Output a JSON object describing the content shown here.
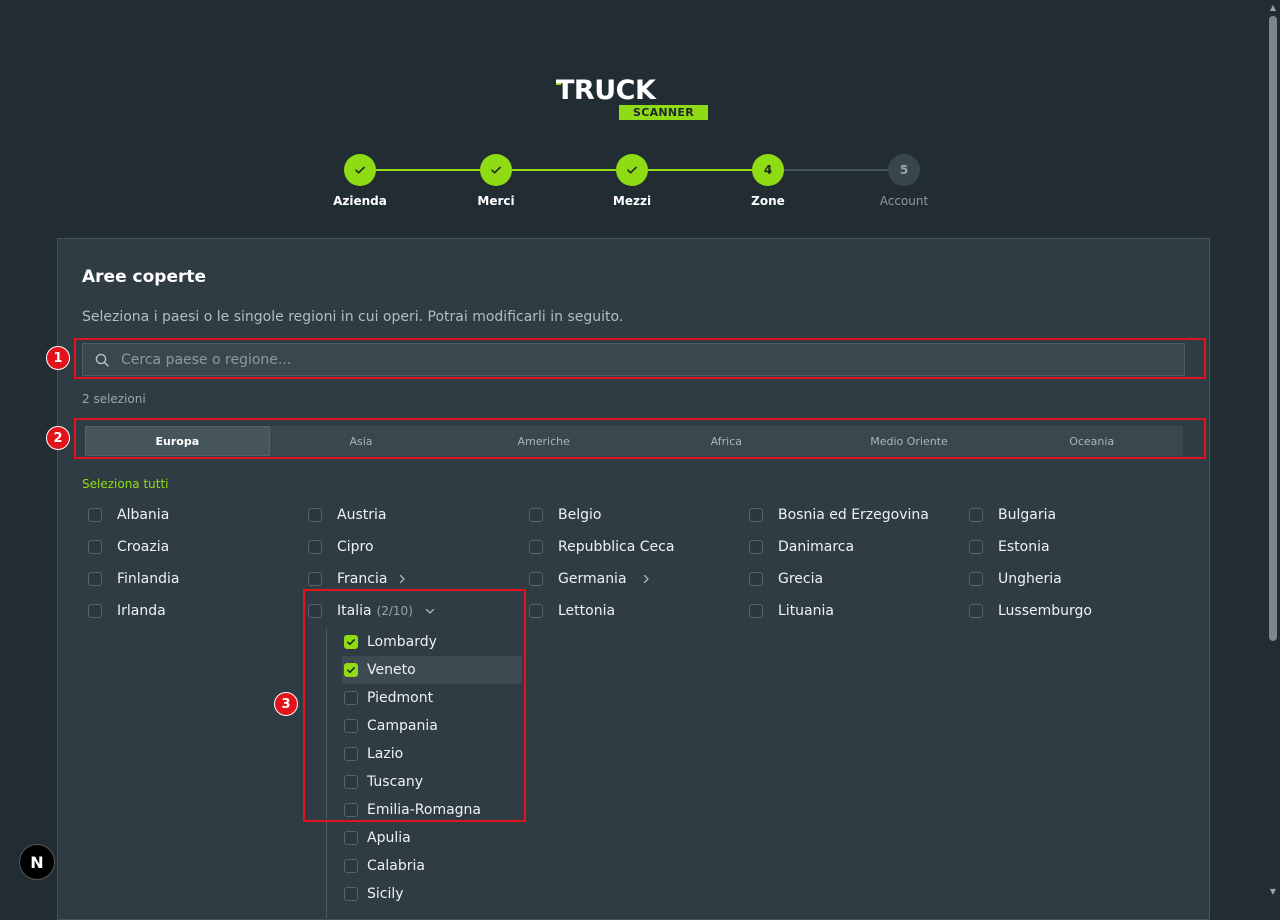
{
  "brand": {
    "word": "TRUCK",
    "badge": "SCANNER",
    "accent": "#8fdc15"
  },
  "stepper": {
    "steps": [
      {
        "label": "Azienda",
        "state": "done",
        "mark": "check"
      },
      {
        "label": "Merci",
        "state": "done",
        "mark": "check"
      },
      {
        "label": "Mezzi",
        "state": "done",
        "mark": "check"
      },
      {
        "label": "Zone",
        "state": "active",
        "number": "4"
      },
      {
        "label": "Account",
        "state": "pending",
        "number": "5"
      }
    ]
  },
  "card": {
    "title": "Aree coperte",
    "subtitle": "Seleziona i paesi o le singole regioni in cui operi. Potrai modificarli in seguito.",
    "search_placeholder": "Cerca paese o regione...",
    "selection_count": "2 selezioni",
    "select_all": "Seleziona tutti",
    "tabs": [
      "Europa",
      "Asia",
      "Americhe",
      "Africa",
      "Medio Oriente",
      "Oceania"
    ],
    "active_tab": "Europa",
    "countries": [
      [
        "Albania",
        "Austria",
        "Belgio",
        "Bosnia ed Erzegovina",
        "Bulgaria"
      ],
      [
        "Croazia",
        "Cipro",
        "Repubblica Ceca",
        "Danimarca",
        "Estonia"
      ],
      [
        "Finlandia",
        "Francia",
        "Germania",
        "Grecia",
        "Ungheria"
      ],
      [
        "Irlanda",
        "Italia",
        "Lettonia",
        "Lituania",
        "Lussemburgo"
      ]
    ],
    "italia_count": "(2/10)",
    "regions": [
      {
        "name": "Lombardy",
        "checked": true
      },
      {
        "name": "Veneto",
        "checked": true
      },
      {
        "name": "Piedmont",
        "checked": false
      },
      {
        "name": "Campania",
        "checked": false
      },
      {
        "name": "Lazio",
        "checked": false
      },
      {
        "name": "Tuscany",
        "checked": false
      },
      {
        "name": "Emilia-Romagna",
        "checked": false
      },
      {
        "name": "Apulia",
        "checked": false
      },
      {
        "name": "Calabria",
        "checked": false
      },
      {
        "name": "Sicily",
        "checked": false
      }
    ]
  },
  "annotations": [
    "1",
    "2",
    "3"
  ],
  "dev_badge": "N"
}
